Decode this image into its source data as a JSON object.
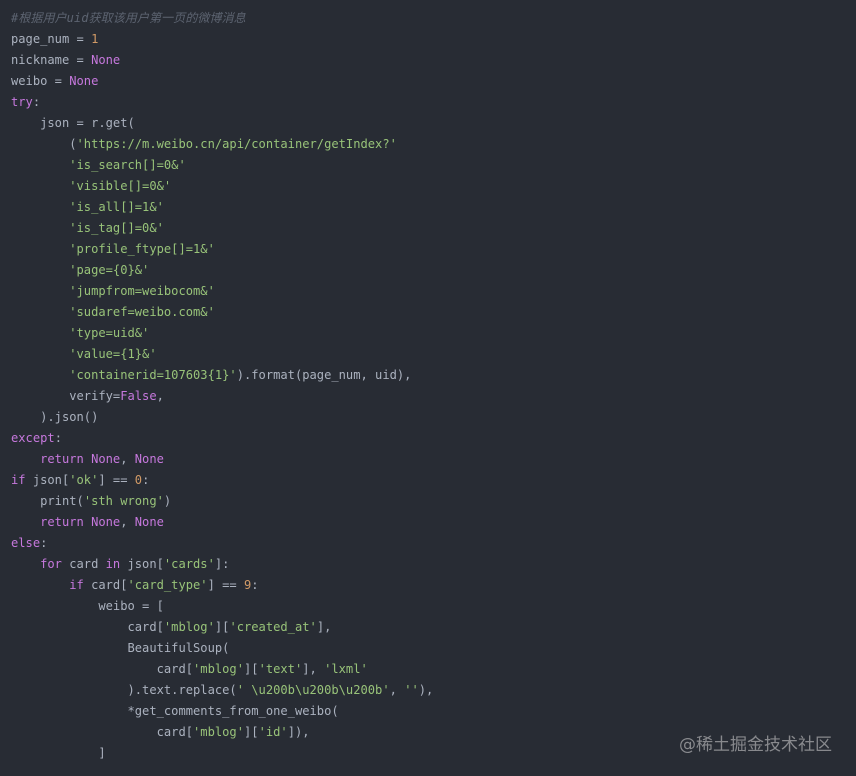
{
  "colors": {
    "background": "#282c34",
    "plain": "#abb2bf",
    "comment": "#5c6370",
    "keyword": "#c678dd",
    "string": "#98c379",
    "number": "#d19a66"
  },
  "code": {
    "language": "python",
    "lines": [
      [
        [
          "comment",
          "#根据用户uid获取该用户第一页的微博消息"
        ]
      ],
      [
        [
          "plain",
          "page_num = "
        ],
        [
          "number",
          "1"
        ]
      ],
      [
        [
          "plain",
          "nickname = "
        ],
        [
          "keyword",
          "None"
        ]
      ],
      [
        [
          "plain",
          "weibo = "
        ],
        [
          "keyword",
          "None"
        ]
      ],
      [
        [
          "keyword",
          "try"
        ],
        [
          "plain",
          ":"
        ]
      ],
      [
        [
          "plain",
          "    json = r.get("
        ]
      ],
      [
        [
          "plain",
          "        ("
        ],
        [
          "string",
          "'https://m.weibo.cn/api/container/getIndex?'"
        ]
      ],
      [
        [
          "plain",
          "        "
        ],
        [
          "string",
          "'is_search[]=0&'"
        ]
      ],
      [
        [
          "plain",
          "        "
        ],
        [
          "string",
          "'visible[]=0&'"
        ]
      ],
      [
        [
          "plain",
          "        "
        ],
        [
          "string",
          "'is_all[]=1&'"
        ]
      ],
      [
        [
          "plain",
          "        "
        ],
        [
          "string",
          "'is_tag[]=0&'"
        ]
      ],
      [
        [
          "plain",
          "        "
        ],
        [
          "string",
          "'profile_ftype[]=1&'"
        ]
      ],
      [
        [
          "plain",
          "        "
        ],
        [
          "string",
          "'page={0}&'"
        ]
      ],
      [
        [
          "plain",
          "        "
        ],
        [
          "string",
          "'jumpfrom=weibocom&'"
        ]
      ],
      [
        [
          "plain",
          "        "
        ],
        [
          "string",
          "'sudaref=weibo.com&'"
        ]
      ],
      [
        [
          "plain",
          "        "
        ],
        [
          "string",
          "'type=uid&'"
        ]
      ],
      [
        [
          "plain",
          "        "
        ],
        [
          "string",
          "'value={1}&'"
        ]
      ],
      [
        [
          "plain",
          "        "
        ],
        [
          "string",
          "'containerid=107603{1}'"
        ],
        [
          "plain",
          ").format(page_num, uid),"
        ]
      ],
      [
        [
          "plain",
          "        verify="
        ],
        [
          "keyword",
          "False"
        ],
        [
          "plain",
          ","
        ]
      ],
      [
        [
          "plain",
          "    ).json()"
        ]
      ],
      [
        [
          "keyword",
          "except"
        ],
        [
          "plain",
          ":"
        ]
      ],
      [
        [
          "plain",
          "    "
        ],
        [
          "keyword",
          "return"
        ],
        [
          "plain",
          " "
        ],
        [
          "keyword",
          "None"
        ],
        [
          "plain",
          ", "
        ],
        [
          "keyword",
          "None"
        ]
      ],
      [
        [
          "keyword",
          "if"
        ],
        [
          "plain",
          " json["
        ],
        [
          "string",
          "'ok'"
        ],
        [
          "plain",
          "] == "
        ],
        [
          "number",
          "0"
        ],
        [
          "plain",
          ":"
        ]
      ],
      [
        [
          "plain",
          "    print("
        ],
        [
          "string",
          "'sth wrong'"
        ],
        [
          "plain",
          ")"
        ]
      ],
      [
        [
          "plain",
          "    "
        ],
        [
          "keyword",
          "return"
        ],
        [
          "plain",
          " "
        ],
        [
          "keyword",
          "None"
        ],
        [
          "plain",
          ", "
        ],
        [
          "keyword",
          "None"
        ]
      ],
      [
        [
          "keyword",
          "else"
        ],
        [
          "plain",
          ":"
        ]
      ],
      [
        [
          "plain",
          "    "
        ],
        [
          "keyword",
          "for"
        ],
        [
          "plain",
          " card "
        ],
        [
          "keyword",
          "in"
        ],
        [
          "plain",
          " json["
        ],
        [
          "string",
          "'cards'"
        ],
        [
          "plain",
          "]:"
        ]
      ],
      [
        [
          "plain",
          "        "
        ],
        [
          "keyword",
          "if"
        ],
        [
          "plain",
          " card["
        ],
        [
          "string",
          "'card_type'"
        ],
        [
          "plain",
          "] == "
        ],
        [
          "number",
          "9"
        ],
        [
          "plain",
          ":"
        ]
      ],
      [
        [
          "plain",
          "            weibo = ["
        ]
      ],
      [
        [
          "plain",
          "                card["
        ],
        [
          "string",
          "'mblog'"
        ],
        [
          "plain",
          "]["
        ],
        [
          "string",
          "'created_at'"
        ],
        [
          "plain",
          "],"
        ]
      ],
      [
        [
          "plain",
          "                BeautifulSoup("
        ]
      ],
      [
        [
          "plain",
          "                    card["
        ],
        [
          "string",
          "'mblog'"
        ],
        [
          "plain",
          "]["
        ],
        [
          "string",
          "'text'"
        ],
        [
          "plain",
          "], "
        ],
        [
          "string",
          "'lxml'"
        ]
      ],
      [
        [
          "plain",
          "                ).text.replace("
        ],
        [
          "string",
          "' \\u200b\\u200b\\u200b'"
        ],
        [
          "plain",
          ", "
        ],
        [
          "string",
          "''"
        ],
        [
          "plain",
          "),"
        ]
      ],
      [
        [
          "plain",
          "                *get_comments_from_one_weibo("
        ]
      ],
      [
        [
          "plain",
          "                    card["
        ],
        [
          "string",
          "'mblog'"
        ],
        [
          "plain",
          "]["
        ],
        [
          "string",
          "'id'"
        ],
        [
          "plain",
          "]),"
        ]
      ],
      [
        [
          "plain",
          "            ]"
        ]
      ]
    ]
  },
  "watermark": {
    "text": "@稀土掘金技术社区"
  }
}
